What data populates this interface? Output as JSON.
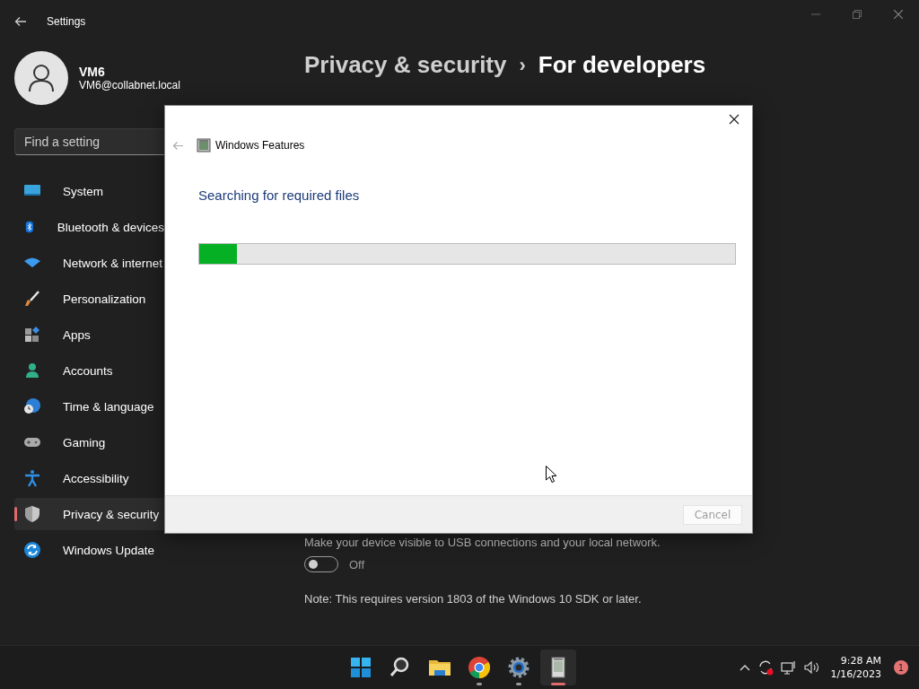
{
  "window": {
    "title": "Settings"
  },
  "account": {
    "name": "VM6",
    "email": "VM6@collabnet.local"
  },
  "search": {
    "placeholder": "Find a setting"
  },
  "sidebar": {
    "items": [
      {
        "label": "System",
        "kind": "system",
        "selected": false
      },
      {
        "label": "Bluetooth & devices",
        "kind": "bluetooth",
        "selected": false
      },
      {
        "label": "Network & internet",
        "kind": "wifi",
        "selected": false
      },
      {
        "label": "Personalization",
        "kind": "brush",
        "selected": false
      },
      {
        "label": "Apps",
        "kind": "apps",
        "selected": false
      },
      {
        "label": "Accounts",
        "kind": "person",
        "selected": false
      },
      {
        "label": "Time & language",
        "kind": "globe",
        "selected": false
      },
      {
        "label": "Gaming",
        "kind": "gamepad",
        "selected": false
      },
      {
        "label": "Accessibility",
        "kind": "accessibility",
        "selected": false
      },
      {
        "label": "Privacy & security",
        "kind": "shield",
        "selected": true
      },
      {
        "label": "Windows Update",
        "kind": "update",
        "selected": false
      }
    ]
  },
  "breadcrumb": {
    "parent": "Privacy & security",
    "separator": "›",
    "current": "For developers"
  },
  "content": {
    "description": "Make your device visible to USB connections and your local network.",
    "toggle": {
      "on": false,
      "label": "Off"
    },
    "note": "Note: This requires version 1803 of the Windows 10 SDK or later."
  },
  "dialog": {
    "title": "Windows Features",
    "heading": "Searching for required files",
    "progress": {
      "level": 0.07
    },
    "buttons": [
      {
        "label": "Cancel",
        "disabled": true
      }
    ]
  },
  "taskbar": {
    "apps": [
      {
        "kind": "start",
        "running": false,
        "active": false
      },
      {
        "kind": "search",
        "running": false,
        "active": false
      },
      {
        "kind": "folder",
        "running": false,
        "active": false
      },
      {
        "kind": "browser",
        "running": true,
        "active": false
      },
      {
        "kind": "settings",
        "running": true,
        "active": false
      },
      {
        "kind": "features",
        "running": true,
        "active": true
      }
    ],
    "time": "9:28 AM",
    "date": "1/16/2023",
    "notifications": "1"
  }
}
